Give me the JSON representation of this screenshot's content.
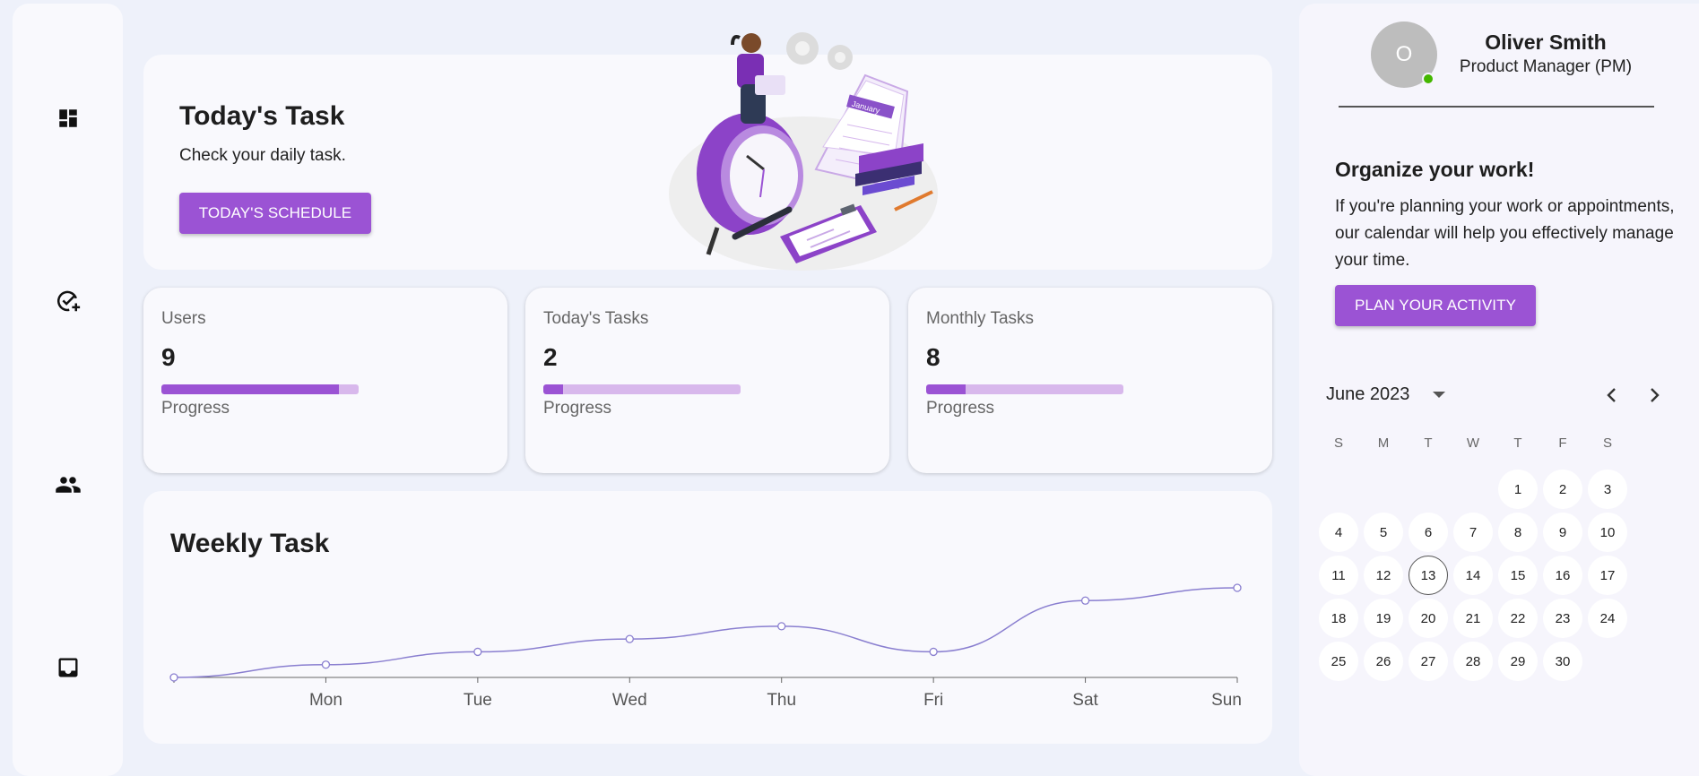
{
  "sidebar": {
    "items": [
      {
        "name": "dashboard-icon"
      },
      {
        "name": "add-task-icon"
      },
      {
        "name": "people-icon"
      },
      {
        "name": "inbox-icon"
      }
    ]
  },
  "hero": {
    "title": "Today's Task",
    "subtitle": "Check your daily task.",
    "button_label": "TODAY'S SCHEDULE",
    "illustration_text": "January"
  },
  "stats": [
    {
      "label": "Users",
      "value": "9",
      "progress_label": "Progress",
      "progress": 0.9
    },
    {
      "label": "Today's Tasks",
      "value": "2",
      "progress_label": "Progress",
      "progress": 0.1
    },
    {
      "label": "Monthly Tasks",
      "value": "8",
      "progress_label": "Progress",
      "progress": 0.2
    }
  ],
  "weekly": {
    "title": "Weekly Task"
  },
  "chart_data": {
    "type": "line",
    "categories": [
      "",
      "Mon",
      "Tue",
      "Wed",
      "Thu",
      "Fri",
      "Sat",
      "Sun"
    ],
    "values": [
      0,
      1,
      2,
      3,
      4,
      2,
      6,
      7
    ],
    "ylim": [
      0,
      7
    ],
    "title": "",
    "xlabel": "",
    "ylabel": "",
    "color": "#8a7fd0",
    "grid": false
  },
  "profile": {
    "initial": "O",
    "name": "Oliver Smith",
    "role": "Product Manager (PM)",
    "status_color": "#44b700"
  },
  "organize": {
    "title": "Organize your work!",
    "text": "If you're planning your work or appointments, our calendar will help you effectively manage your time.",
    "button_label": "PLAN YOUR ACTIVITY"
  },
  "calendar": {
    "month_label": "June 2023",
    "weekdays": [
      "S",
      "M",
      "T",
      "W",
      "T",
      "F",
      "S"
    ],
    "first_weekday": 4,
    "days_in_month": 30,
    "today": 13
  },
  "colors": {
    "accent": "#9b53d4",
    "accent_light": "#d8b8ec",
    "background": "#eef1fa",
    "card": "#f9f9fd"
  }
}
